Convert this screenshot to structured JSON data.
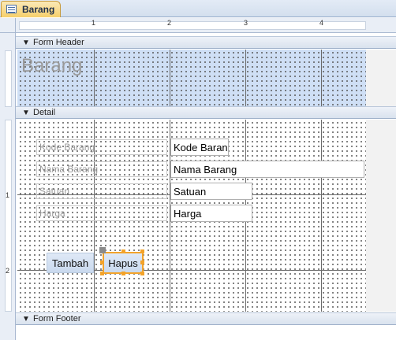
{
  "tab": {
    "title": "Barang",
    "icon": "form-icon"
  },
  "ruler": {
    "h_numbers": [
      "1",
      "2",
      "3",
      "4"
    ],
    "v_numbers": [
      "1",
      "2"
    ]
  },
  "sections": {
    "header": "Form Header",
    "detail": "Detail",
    "footer": "Form Footer"
  },
  "form_header": {
    "title": "Barang"
  },
  "fields": [
    {
      "label": "Kode Barang",
      "value": "Kode Baran"
    },
    {
      "label": "Nama Barang",
      "value": "Nama Barang"
    },
    {
      "label": "Satuan",
      "value": "Satuan"
    },
    {
      "label": "Harga",
      "value": "Harga"
    }
  ],
  "buttons": {
    "tambah": "Tambah",
    "hapus": "Hapus"
  },
  "colors": {
    "header_fill": "#cfdff5",
    "selection": "#f3a32a",
    "button_fill": "#c9d9ee"
  }
}
